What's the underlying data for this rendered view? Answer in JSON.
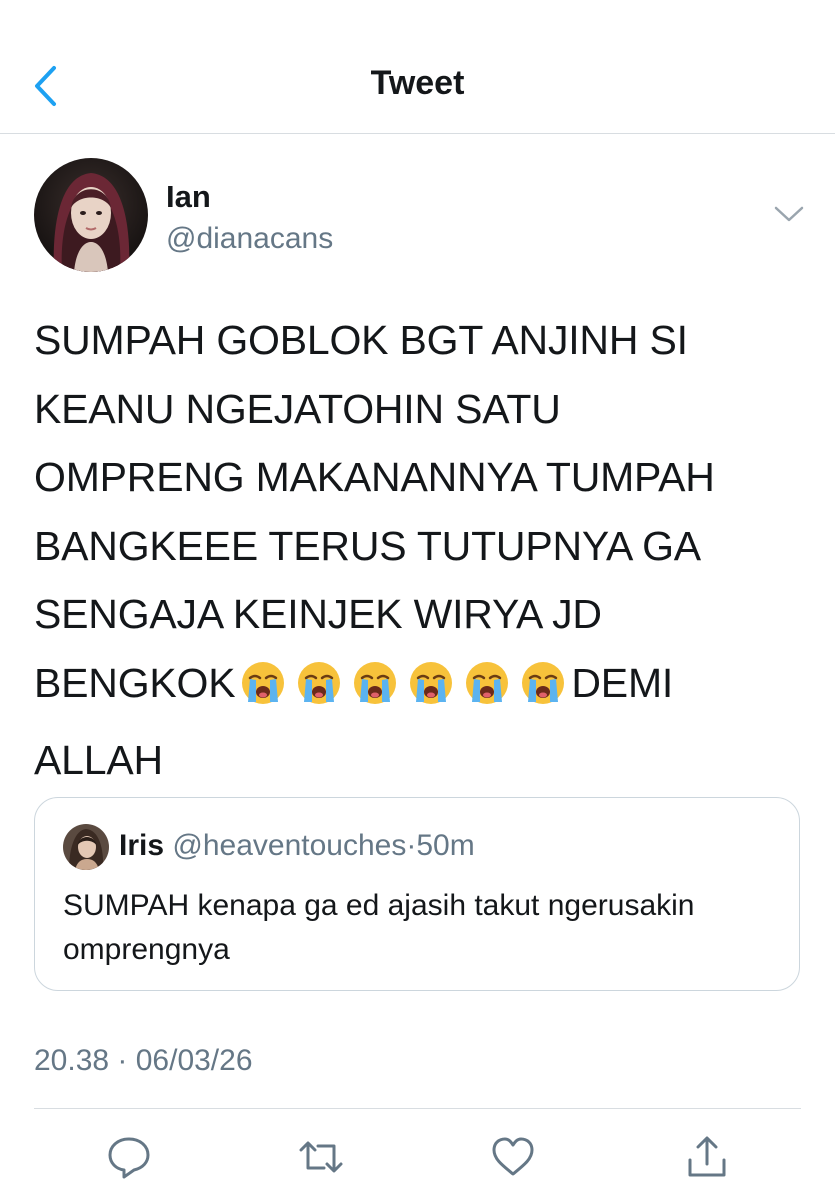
{
  "header": {
    "title": "Tweet",
    "back_icon": "chevron-left-icon"
  },
  "tweet": {
    "display_name": "Ian",
    "handle": "@dianacans",
    "lines": [
      "SUMPAH GOBLOK BGT ANJINH SI",
      "KEANU NGEJATOHIN SATU",
      "OMPRENG MAKANANNYA TUMPAH",
      "BANGKEEE TERUS TUTUPNYA GA",
      "SENGAJA KEINJEK WIRYA JD"
    ],
    "line6_start": "BENGKOK",
    "emoji": "😭",
    "emoji_count": 6,
    "line6_end": "DEMI",
    "line7": "ALLAH",
    "timestamp": "20.38 · 06/03/26"
  },
  "quote": {
    "name": "Iris",
    "handle": "@heaventouches",
    "separator": "·",
    "time": "50m",
    "text": "SUMPAH kenapa ga ed ajasih takut ngerusakin omprengnya"
  },
  "actions": [
    "reply-icon",
    "retweet-icon",
    "like-icon",
    "share-icon"
  ],
  "colors": {
    "accent": "#1da1f2",
    "secondary_text": "#657786",
    "border": "#ccd6dd"
  }
}
